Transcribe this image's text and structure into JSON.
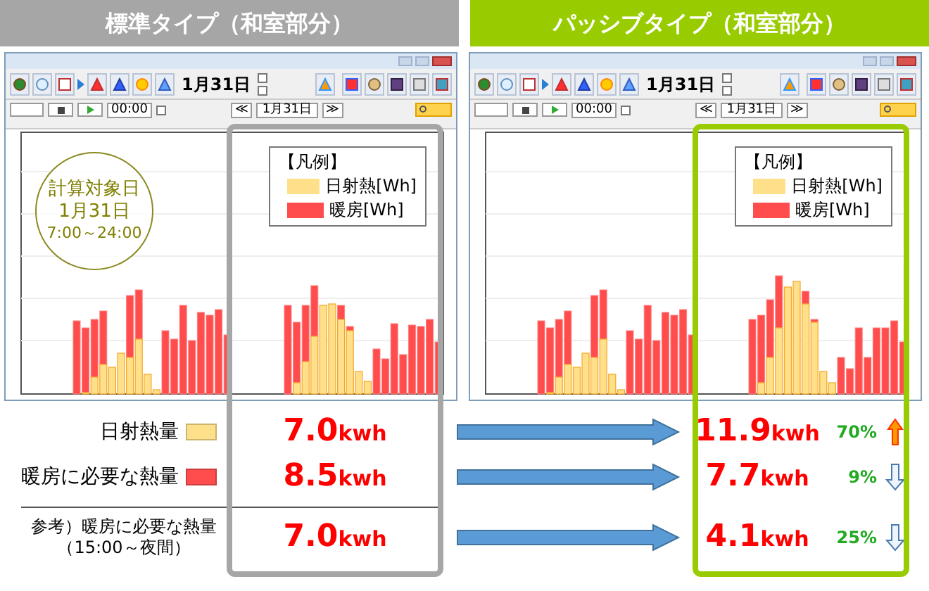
{
  "headers": [
    {
      "label": "標準タイプ（和室部分）",
      "kind": "standard"
    },
    {
      "label": "パッシブタイプ（和室部分）",
      "kind": "passive"
    }
  ],
  "windows": [
    {
      "kind": "standard",
      "toolbar_date": "1月31日",
      "time": "00:00",
      "nav_prev": "≪",
      "nav_date": "1月31日",
      "nav_next": "≫",
      "checkboxes": [
        {
          "checked": false
        },
        {
          "checked": false
        },
        {
          "checked": false
        }
      ],
      "note": {
        "lines": [
          "計算対象日",
          "1月31日",
          "7:00～24:00"
        ]
      }
    },
    {
      "kind": "passive",
      "toolbar_date": "1月31日",
      "time": "00:00",
      "nav_prev": "≪",
      "nav_date": "1月31日",
      "nav_next": "≫",
      "checkboxes": [
        {
          "checked": false
        },
        {
          "checked": false
        },
        {
          "checked": false
        }
      ]
    }
  ],
  "highlights": [
    {
      "kind": "standard",
      "legend": {
        "title": "【凡例】",
        "items": [
          {
            "label": "日射熱[Wh]",
            "color": "#ffe08a"
          },
          {
            "label": "暖房[Wh]",
            "color": "#ff4d4d"
          }
        ]
      }
    },
    {
      "kind": "passive",
      "legend": {
        "title": "【凡例】",
        "items": [
          {
            "label": "日射熱[Wh]",
            "color": "#ffe08a"
          },
          {
            "label": "暖房[Wh]",
            "color": "#ff4d4d"
          }
        ]
      }
    }
  ],
  "table": {
    "rows": [
      {
        "label": "日射熱量",
        "color": "#ffe08a",
        "divider_before": false,
        "standard": {
          "value": "7.0",
          "unit": "kwh"
        },
        "passive": {
          "value": "11.9",
          "unit": "kwh",
          "percent": "70%",
          "increase": true
        }
      },
      {
        "label": "暖房に必要な熱量",
        "color": "#ff4d4d",
        "divider_before": false,
        "standard": {
          "value": "8.5",
          "unit": "kwh"
        },
        "passive": {
          "value": "7.7",
          "unit": "kwh",
          "percent": "9%",
          "increase": false
        }
      },
      {
        "label": "参考）暖房に必要な熱量",
        "sublabel": "（15:00～夜間）",
        "divider_before": true,
        "standard": {
          "value": "7.0",
          "unit": "kwh"
        },
        "passive": {
          "value": "4.1",
          "unit": "kwh",
          "percent": "25%",
          "increase": false
        }
      }
    ]
  }
}
